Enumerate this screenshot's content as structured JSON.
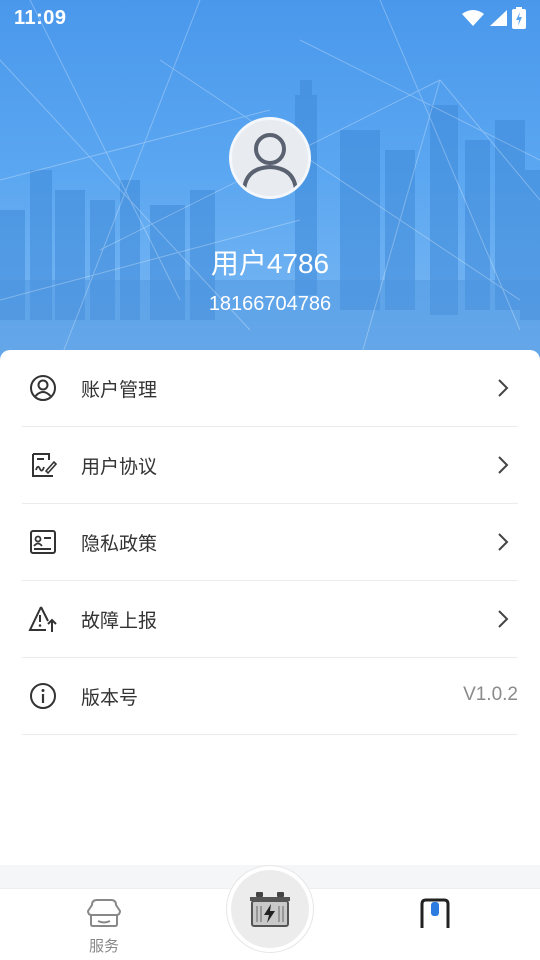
{
  "status_bar": {
    "time": "11:09",
    "icons": [
      "wifi-icon",
      "signal-icon",
      "battery-charging-icon"
    ]
  },
  "profile": {
    "username": "用户4786",
    "phone": "18166704786",
    "avatar_icon": "user-avatar-icon"
  },
  "menu": {
    "items": [
      {
        "label": "账户管理",
        "icon": "account-icon",
        "trailing": "chevron-right-icon"
      },
      {
        "label": "用户协议",
        "icon": "agreement-icon",
        "trailing": "chevron-right-icon"
      },
      {
        "label": "隐私政策",
        "icon": "privacy-icon",
        "trailing": "chevron-right-icon"
      },
      {
        "label": "故障上报",
        "icon": "warning-report-icon",
        "trailing": "chevron-right-icon"
      },
      {
        "label": "版本号",
        "icon": "info-icon",
        "trailing_text": "V1.0.2"
      }
    ]
  },
  "bottom_nav": {
    "service_label": "服务",
    "service_icon": "service-icon",
    "center_icon": "battery-charge-icon",
    "mine_icon": "profile-tab-icon"
  },
  "colors": {
    "hero_blue": "#4a98ec",
    "accent_tab": "#2b7be0",
    "text": "#333333",
    "muted": "#8a8a8a"
  }
}
